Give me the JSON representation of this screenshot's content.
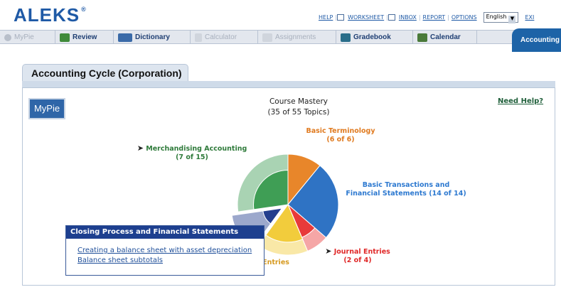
{
  "logo": "ALEKS",
  "toplinks": [
    {
      "label": "HELP",
      "icon": ""
    },
    {
      "label": "WORKSHEET",
      "icon": "worksheet-icon"
    },
    {
      "label": "INBOX",
      "icon": "inbox-icon"
    },
    {
      "label": "REPORT",
      "icon": ""
    },
    {
      "label": "OPTIONS",
      "icon": ""
    }
  ],
  "language": "English",
  "exit_label": "EXI",
  "tabs": [
    {
      "label": "MyPie",
      "enabled": false,
      "icon": "pie-icon",
      "color": "#8a94a4"
    },
    {
      "label": "Review",
      "enabled": true,
      "icon": "checkmark-icon",
      "color": "#3f8a3a"
    },
    {
      "label": "Dictionary",
      "enabled": true,
      "icon": "book-icon",
      "color": "#3a6aa8"
    },
    {
      "label": "Calculator",
      "enabled": false,
      "icon": "calculator-icon",
      "color": "#b8bfca"
    },
    {
      "label": "Assignments",
      "enabled": false,
      "icon": "pencil-icon",
      "color": "#b8bfca"
    },
    {
      "label": "Gradebook",
      "enabled": true,
      "icon": "gradebook-icon",
      "color": "#2a6e8a"
    },
    {
      "label": "Calendar",
      "enabled": true,
      "icon": "calendar-icon",
      "color": "#4a7a3a"
    }
  ],
  "active_tab": "Accounting",
  "section_title": "Accounting Cycle (Corporation)",
  "mypie_button": "MyPie",
  "need_help": "Need Help?",
  "mastery": {
    "title": "Course Mastery",
    "count": "(35 of 55 Topics)"
  },
  "segments": [
    {
      "name": "Basic Terminology",
      "count": "(6 of 6)",
      "mastered": 6,
      "total": 6,
      "color": "#e8862a"
    },
    {
      "name": "Basic Transactions and Financial Statements",
      "count": "(14 of 14)",
      "mastered": 14,
      "total": 14,
      "color": "#2f73c4"
    },
    {
      "name": "Journal Entries",
      "count": "(2 of 4)",
      "mastered": 2,
      "total": 4,
      "color": "#e83a3a"
    },
    {
      "name": "Adjusting Entries",
      "count": "",
      "mastered": 5,
      "total": 9,
      "color": "#f2cc3c"
    },
    {
      "name": "Closing Process and Financial Statements",
      "count": "",
      "mastered": 1,
      "total": 7,
      "color": "#243e8e"
    },
    {
      "name": "Merchandising Accounting",
      "count": "(7 of 15)",
      "mastered": 7,
      "total": 15,
      "color": "#3f9e55"
    }
  ],
  "label_lines": {
    "basic_terminology": "Basic Terminology",
    "basic_terminology_count": "(6 of 6)",
    "basic_transactions_1": "Basic Transactions and",
    "basic_transactions_2": "Financial Statements (14 of 14)",
    "merch_1": "Merchandising Accounting",
    "merch_2": "(7 of 15)",
    "journal_1": "Journal Entries",
    "journal_2": "(2 of 4)",
    "adjusting_partial": "Entries"
  },
  "popup": {
    "title": "Closing Process and Financial Statements",
    "links": [
      "Creating a balance sheet with asset depreciation",
      "Balance sheet subtotals"
    ]
  }
}
